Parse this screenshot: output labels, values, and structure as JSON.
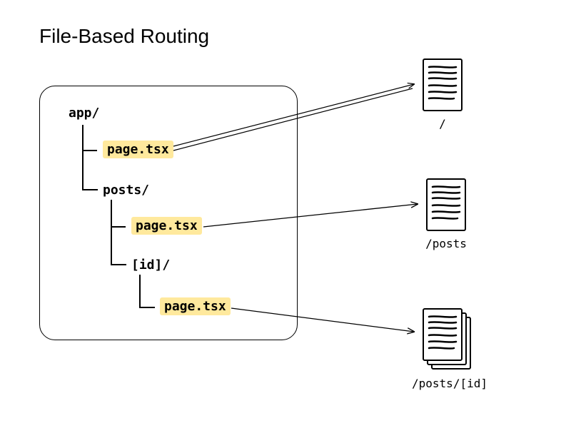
{
  "title": "File-Based Routing",
  "tree": {
    "root": "app/",
    "root_page": "page.tsx",
    "posts_dir": "posts/",
    "posts_page": "page.tsx",
    "id_dir": "[id]/",
    "id_page": "page.tsx"
  },
  "routes": {
    "root": "/",
    "posts": "/posts",
    "post_id": "/posts/[id]"
  },
  "highlight_color": "#ffe99d"
}
